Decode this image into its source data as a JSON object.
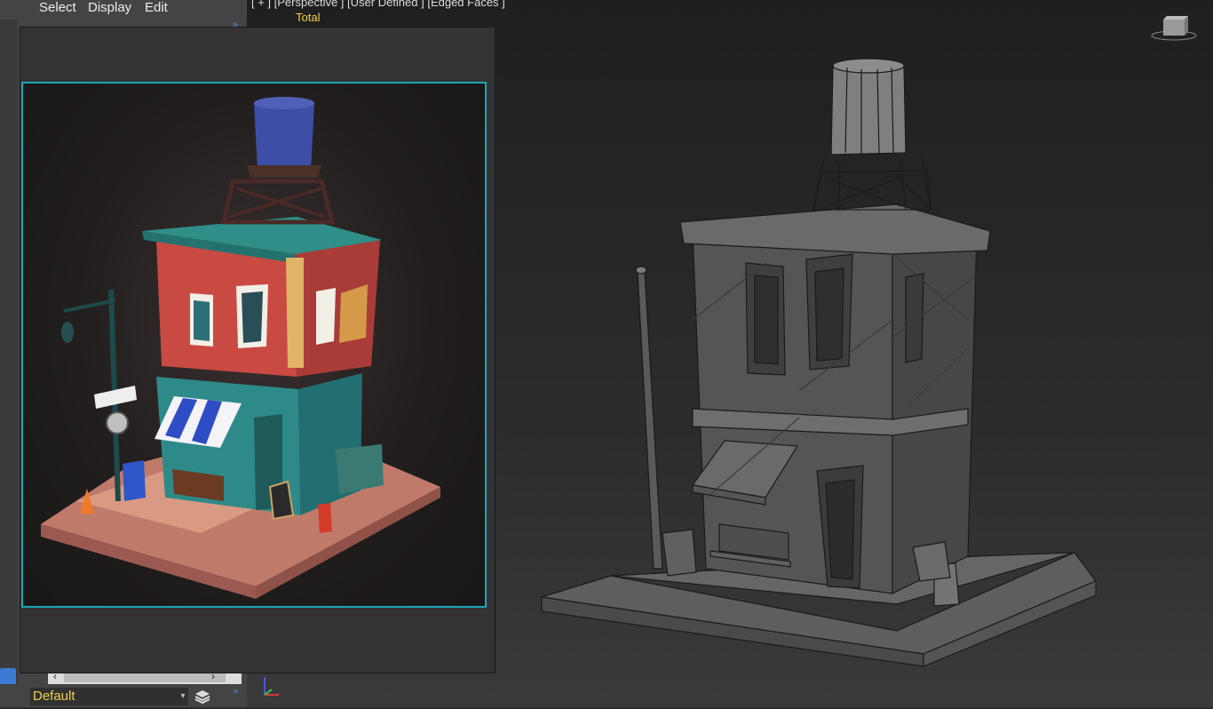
{
  "menu": {
    "select": "Select",
    "display": "Display",
    "edit": "Edit"
  },
  "viewport": {
    "label": "[ + ] [Perspective ] [User Defined ] [Edged Faces ]",
    "stat": "Total"
  },
  "layer": {
    "value": "Default"
  },
  "colors": {
    "accent_frame": "#1aa7b8",
    "label_yellow": "#f1d04a",
    "panel_bg": "#444444"
  },
  "icons": [
    "chevron-right-icon",
    "layers-icon",
    "axis-gizmo-icon",
    "viewcube-icon",
    "dropdown-arrow-icon"
  ]
}
